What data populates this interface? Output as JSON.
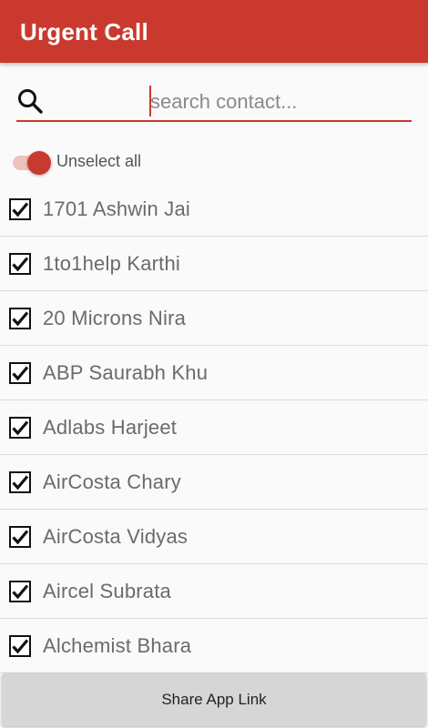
{
  "app": {
    "title": "Urgent Call",
    "accent_color": "#c9392d"
  },
  "search": {
    "placeholder": "search contact...",
    "value": "",
    "icon": "search-icon"
  },
  "toggle": {
    "label": "Unselect all",
    "on": true
  },
  "contacts": [
    {
      "name": "1701 Ashwin Jai",
      "checked": true
    },
    {
      "name": "1to1help Karthi",
      "checked": true
    },
    {
      "name": "20 Microns Nira",
      "checked": true
    },
    {
      "name": "ABP Saurabh Khu",
      "checked": true
    },
    {
      "name": "Adlabs Harjeet",
      "checked": true
    },
    {
      "name": "AirCosta Chary",
      "checked": true
    },
    {
      "name": "AirCosta Vidyas",
      "checked": true
    },
    {
      "name": "Aircel Subrata",
      "checked": true
    },
    {
      "name": "Alchemist Bhara",
      "checked": true
    }
  ],
  "footer": {
    "share_label": "Share App Link"
  }
}
